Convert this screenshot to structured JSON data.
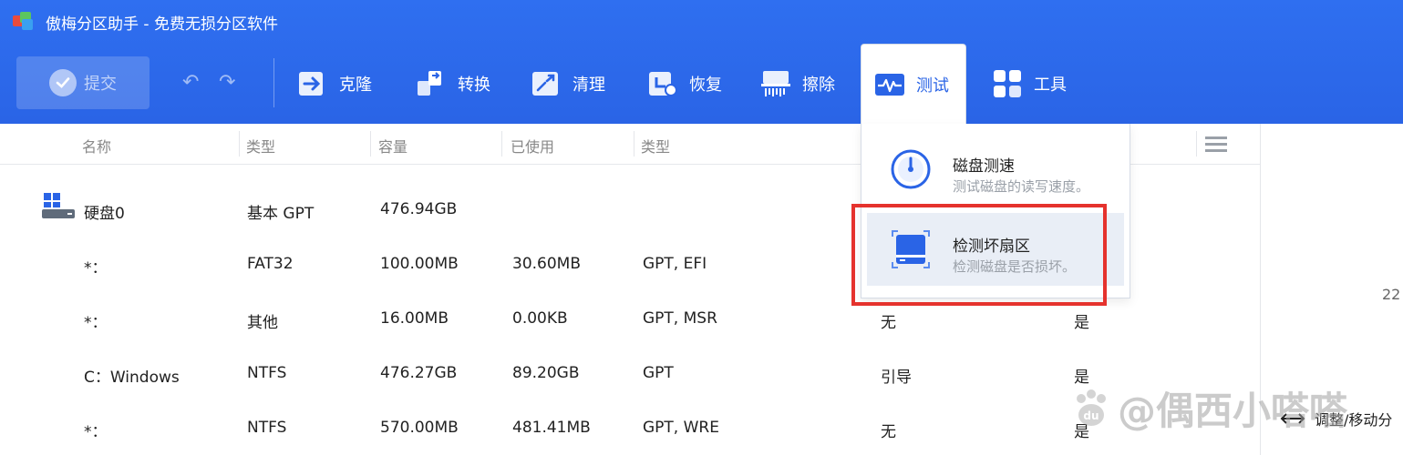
{
  "app": {
    "title": "傲梅分区助手 - 免费无损分区软件"
  },
  "toolbar": {
    "submit_label": "提交",
    "items": [
      {
        "label": "克隆",
        "icon": "clone-icon"
      },
      {
        "label": "转换",
        "icon": "convert-icon"
      },
      {
        "label": "清理",
        "icon": "clean-icon"
      },
      {
        "label": "恢复",
        "icon": "recover-icon"
      },
      {
        "label": "擦除",
        "icon": "wipe-icon"
      },
      {
        "label": "测试",
        "icon": "pulse-icon"
      },
      {
        "label": "工具",
        "icon": "grid-icon"
      }
    ]
  },
  "table": {
    "headers": [
      "名称",
      "类型",
      "容量",
      "已使用",
      "类型"
    ],
    "rows": [
      {
        "name": "硬盘0",
        "type": "基本 GPT",
        "capacity": "476.94GB",
        "used": "",
        "fs_type": "",
        "c6": "",
        "c7": ""
      },
      {
        "name": "*：",
        "type": "FAT32",
        "capacity": "100.00MB",
        "used": "30.60MB",
        "fs_type": "GPT, EFI",
        "c6": "",
        "c7": ""
      },
      {
        "name": "*：",
        "type": "其他",
        "capacity": "16.00MB",
        "used": "0.00KB",
        "fs_type": "GPT, MSR",
        "c6": "无",
        "c7": "是"
      },
      {
        "name": "C：Windows",
        "type": "NTFS",
        "capacity": "476.27GB",
        "used": "89.20GB",
        "fs_type": "GPT",
        "c6": "引导",
        "c7": "是"
      },
      {
        "name": "*：",
        "type": "NTFS",
        "capacity": "570.00MB",
        "used": "481.41MB",
        "fs_type": "GPT, WRE",
        "c6": "无",
        "c7": "是"
      }
    ]
  },
  "dropdown": {
    "items": [
      {
        "title": "磁盘测速",
        "desc": "测试磁盘的读写速度。"
      },
      {
        "title": "检测坏扇区",
        "desc": "检测磁盘是否损坏。"
      }
    ]
  },
  "right_panel": {
    "number": "22",
    "resize_label": "调整/移动分"
  },
  "watermark": {
    "text": "@偶西小嗒嗒",
    "badge": "du"
  },
  "colors": {
    "header_blue": "#2a64e6",
    "highlight_red": "#e5322d"
  }
}
